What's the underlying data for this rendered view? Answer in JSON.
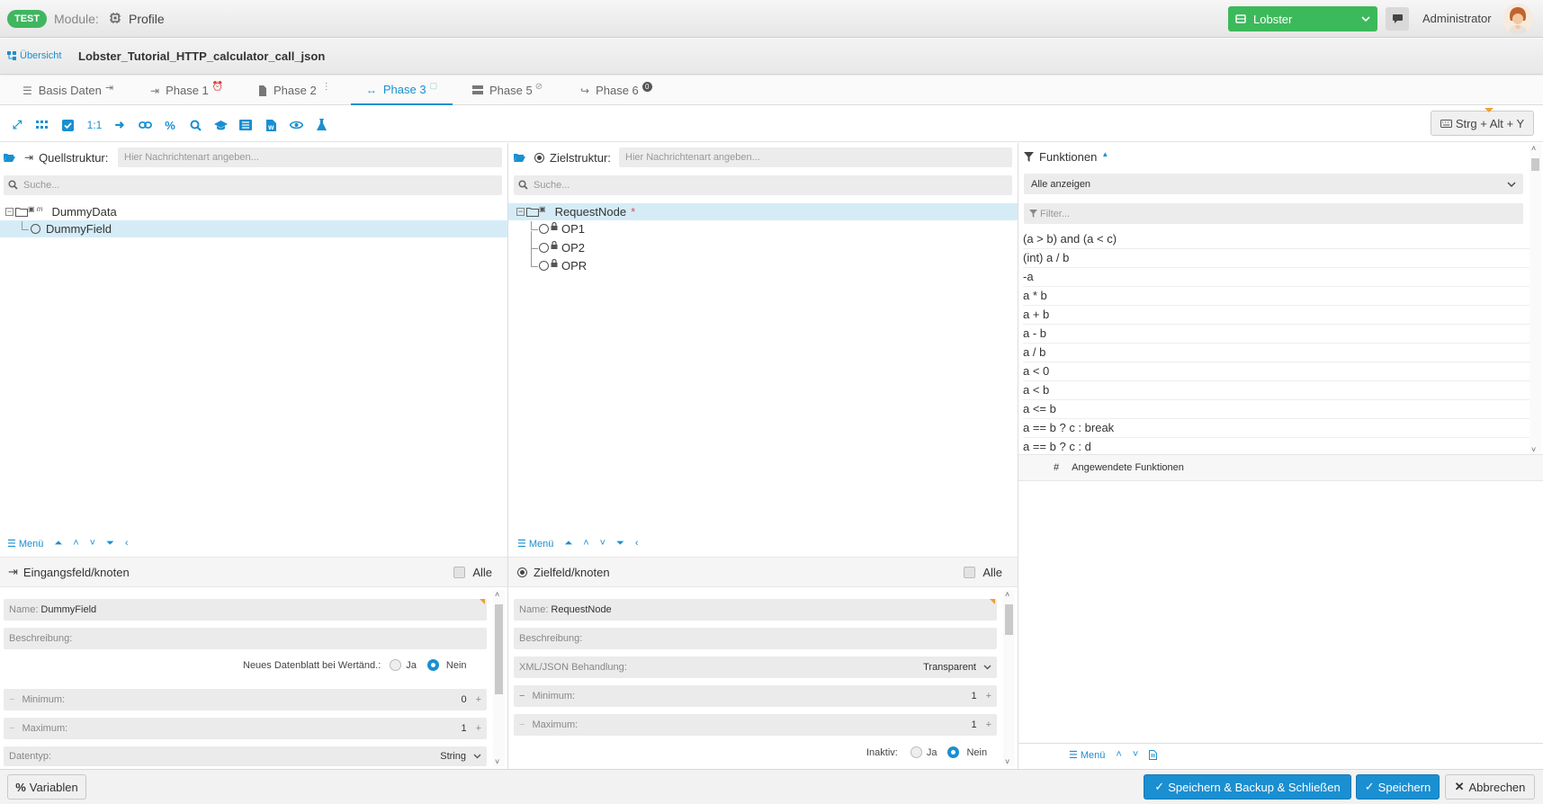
{
  "header": {
    "badge": "TEST",
    "module_label": "Module:",
    "profile_label": "Profile",
    "workspace": "Lobster",
    "user": "Administrator"
  },
  "titlebar": {
    "overview": "Übersicht",
    "profile_name": "Lobster_Tutorial_HTTP_calculator_call_json"
  },
  "tabs": [
    {
      "label": "Basis Daten",
      "icon": "list-icon",
      "suffix_icon": "sign-in-icon"
    },
    {
      "label": "Phase 1",
      "icon": "arrow-right-bar-icon",
      "suffix_icon": "alarm-clock-icon"
    },
    {
      "label": "Phase 2",
      "icon": "file-icon",
      "suffix_icon": "dots-vertical-icon"
    },
    {
      "label": "Phase 3",
      "icon": "arrows-horizontal-icon",
      "suffix_icon": "check-box-icon",
      "active": true
    },
    {
      "label": "Phase 5",
      "icon": "server-icon",
      "suffix_icon": "ban-icon"
    },
    {
      "label": "Phase 6",
      "icon": "share-icon",
      "suffix_icon": "badge-zero-icon",
      "suffix_text": "0"
    }
  ],
  "toolbar": {
    "one_to_one": "1:1",
    "shortcut": "Strg + Alt + Y"
  },
  "source": {
    "label": "Quellstruktur:",
    "msg_placeholder": "Hier Nachrichtenart angeben...",
    "search_placeholder": "Suche...",
    "tree": [
      {
        "label": "DummyData"
      },
      {
        "label": "DummyField"
      }
    ],
    "menu": "Menü",
    "section_title": "Eingangsfeld/knoten",
    "all_label": "Alle",
    "name_label": "Name:",
    "name_value": "DummyField",
    "desc_label": "Beschreibung:",
    "new_sheet_label": "Neues Datenblatt bei Wertänd.:",
    "yes": "Ja",
    "no": "Nein",
    "min_label": "Minimum:",
    "min_value": "0",
    "max_label": "Maximum:",
    "max_value": "1",
    "datatype_label": "Datentyp:",
    "datatype_value": "String"
  },
  "target": {
    "label": "Zielstruktur:",
    "msg_placeholder": "Hier Nachrichtenart angeben...",
    "search_placeholder": "Suche...",
    "tree": [
      {
        "label": "RequestNode",
        "required": "*"
      },
      {
        "label": "OP1"
      },
      {
        "label": "OP2"
      },
      {
        "label": "OPR"
      }
    ],
    "menu": "Menü",
    "section_title": "Zielfeld/knoten",
    "all_label": "Alle",
    "name_label": "Name:",
    "name_value": "RequestNode",
    "desc_label": "Beschreibung:",
    "xml_label": "XML/JSON Behandlung:",
    "xml_value": "Transparent",
    "min_label": "Minimum:",
    "min_value": "1",
    "max_label": "Maximum:",
    "max_value": "1",
    "inactive_label": "Inaktiv:",
    "yes": "Ja",
    "no": "Nein"
  },
  "functions": {
    "title": "Funktionen",
    "filter_select": "Alle anzeigen",
    "filter_placeholder": "Filter...",
    "items": [
      "(a > b) and (a < c)",
      "(int) a / b",
      "-a",
      "a * b",
      "a + b",
      "a - b",
      "a / b",
      "a < 0",
      "a < b",
      "a <= b",
      "a == b ? c : break",
      "a == b ? c : d"
    ],
    "applied_hash": "#",
    "applied_title": "Angewendete Funktionen",
    "menu": "Menü"
  },
  "bottom": {
    "variables": "Variablen",
    "save_backup_close": "Speichern & Backup & Schließen",
    "save": "Speichern",
    "cancel": "Abbrechen"
  },
  "colors": {
    "accent": "#1a8fd1",
    "workspace_green": "#3cb95a",
    "badge_green": "#3fb65f",
    "selection": "#d5ecf7"
  }
}
